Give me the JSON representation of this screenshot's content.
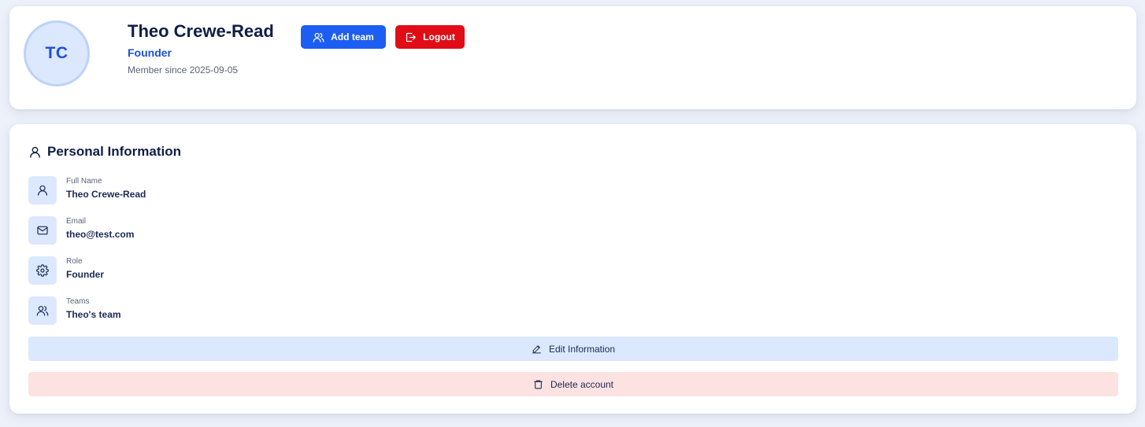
{
  "profile": {
    "initials": "TC",
    "name": "Theo Crewe-Read",
    "role": "Founder",
    "member_since": "Member since 2025-09-05",
    "add_team_label": "Add team",
    "logout_label": "Logout"
  },
  "personal_info": {
    "title": "Personal Information",
    "fields": [
      {
        "label": "Full Name",
        "value": "Theo Crewe-Read",
        "icon": "user-icon"
      },
      {
        "label": "Email",
        "value": "theo@test.com",
        "icon": "mail-icon"
      },
      {
        "label": "Role",
        "value": "Founder",
        "icon": "gear-icon"
      },
      {
        "label": "Teams",
        "value": "Theo's team",
        "icon": "users-icon"
      }
    ],
    "edit_label": "Edit Information",
    "delete_label": "Delete account"
  },
  "colors": {
    "primary": "#1d5ef2",
    "danger": "#e00d17",
    "avatar_bg": "#dbe8fe",
    "edit_bg": "#dbe8fe",
    "delete_bg": "#fde2e2",
    "page_bg": "#edf1fa"
  }
}
